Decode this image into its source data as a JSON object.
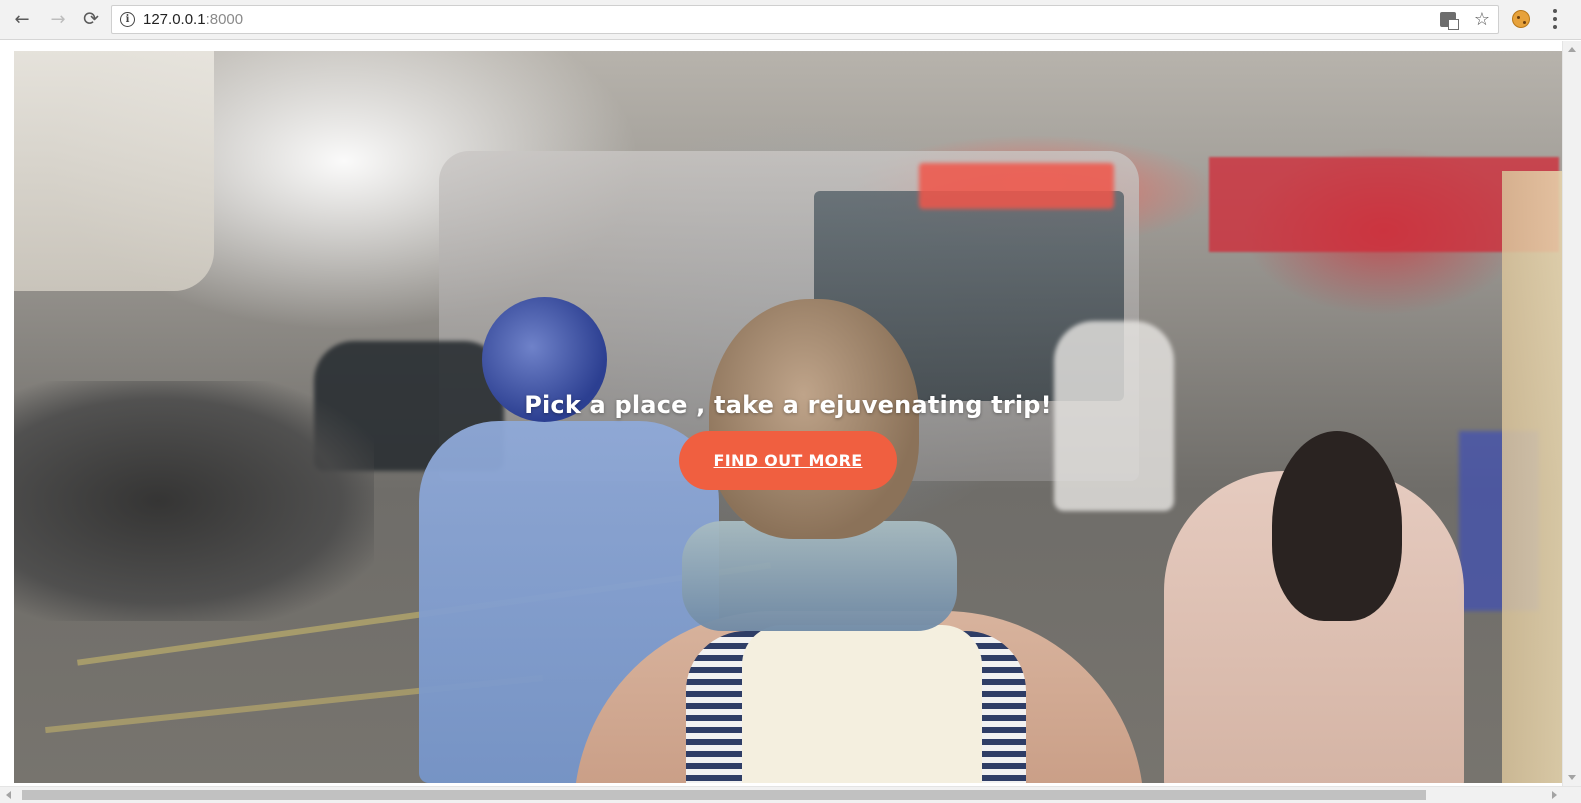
{
  "browser": {
    "url_host": "127.0.0.1",
    "url_port": ":8000",
    "icons": {
      "back": "back-arrow-icon",
      "forward": "forward-arrow-icon",
      "reload": "reload-icon",
      "site_info": "info-icon",
      "translate": "translate-icon",
      "bookmark": "star-icon",
      "extension": "cookie-icon",
      "menu": "kebab-menu-icon"
    }
  },
  "hero": {
    "title": "Pick a place , take a rejuvenating trip!",
    "cta_label": "FIND OUT MORE",
    "accent_color": "#f05f40"
  }
}
